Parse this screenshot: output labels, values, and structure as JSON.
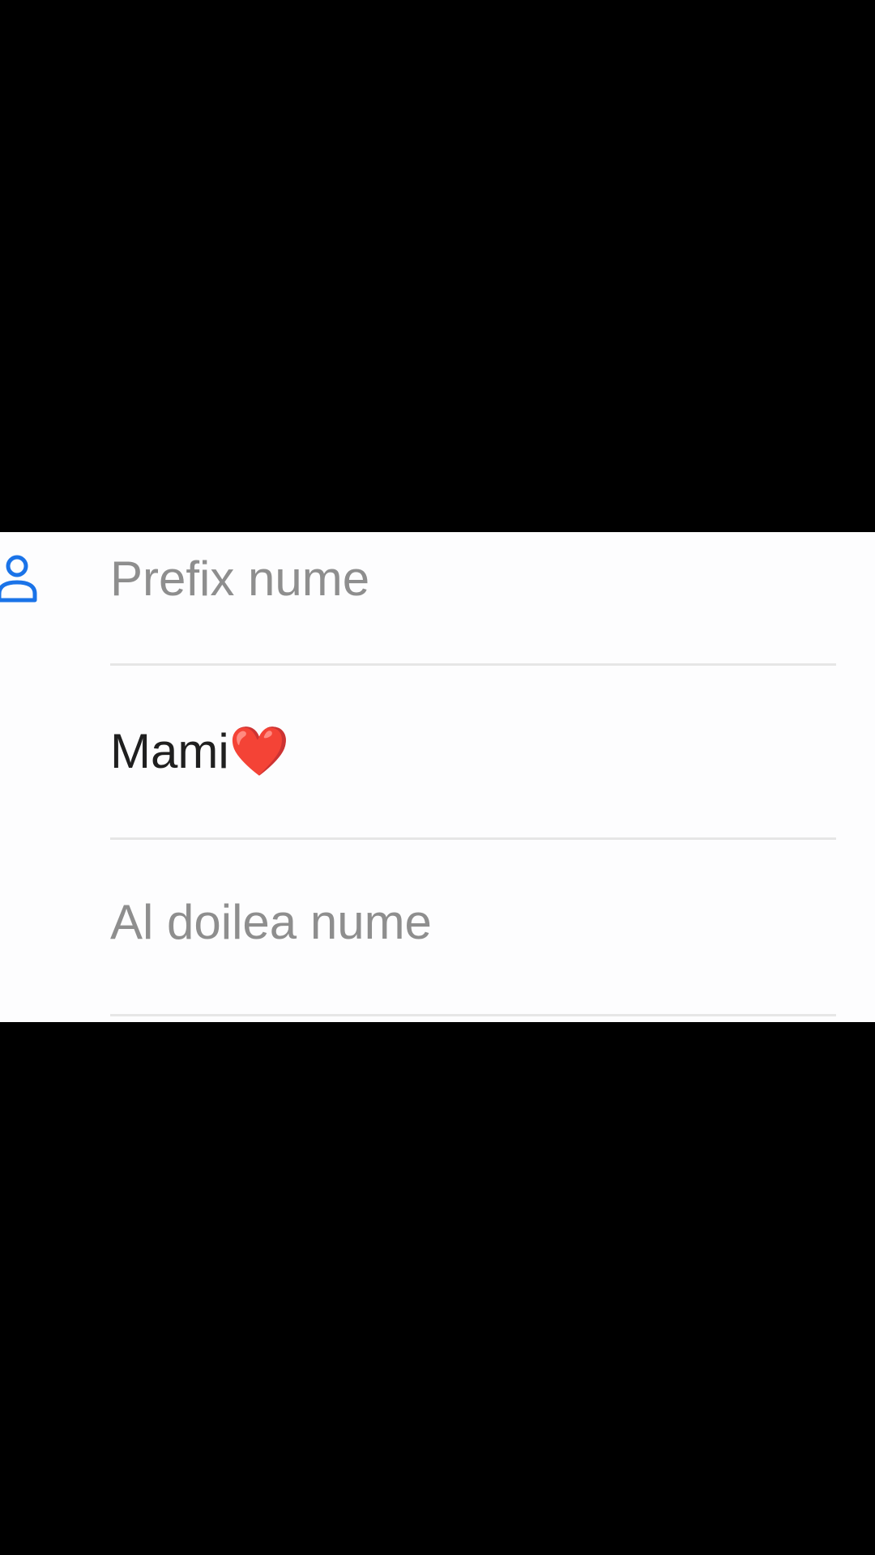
{
  "form": {
    "icon": "person-icon",
    "accent_color": "#1a73e8",
    "prefix_field": {
      "placeholder": "Prefix nume",
      "value": ""
    },
    "first_name_field": {
      "value": "Mami",
      "emoji": "❤️"
    },
    "middle_name_field": {
      "placeholder": "Al doilea nume",
      "value": ""
    }
  }
}
